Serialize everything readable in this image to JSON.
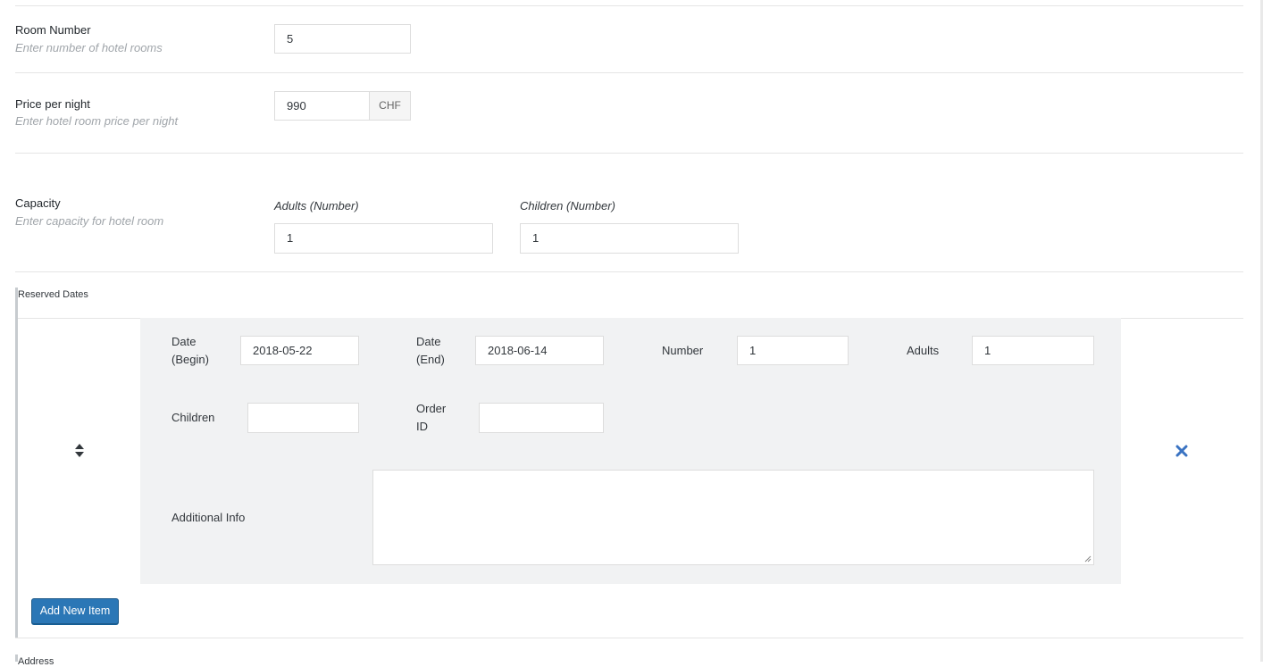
{
  "room_number": {
    "label": "Room Number",
    "description": "Enter number of hotel rooms",
    "value": "5"
  },
  "price": {
    "label": "Price per night",
    "description": "Enter hotel room price per night",
    "value": "990",
    "currency": "CHF"
  },
  "capacity": {
    "label": "Capacity",
    "description": "Enter capacity for hotel room",
    "adults_label": "Adults (Number)",
    "adults_value": "1",
    "children_label": "Children (Number)",
    "children_value": "1"
  },
  "reserved_dates": {
    "label": "Reserved Dates",
    "item": {
      "date_begin_label": "Date (Begin)",
      "date_begin_value": "2018-05-22",
      "date_end_label": "Date (End)",
      "date_end_value": "2018-06-14",
      "number_label": "Number",
      "number_value": "1",
      "adults_label": "Adults",
      "adults_value": "1",
      "children_label": "Children",
      "children_value": "",
      "order_id_label": "Order ID",
      "order_id_value": "",
      "additional_info_label": "Additional Info",
      "additional_info_value": ""
    },
    "add_button_label": "Add New Item"
  },
  "address": {
    "label": "Address"
  },
  "icons": {
    "sort": "sort-icon",
    "remove": "remove-x-icon"
  },
  "colors": {
    "accent": "#2b77b6",
    "remove_icon": "#3a73c2"
  }
}
